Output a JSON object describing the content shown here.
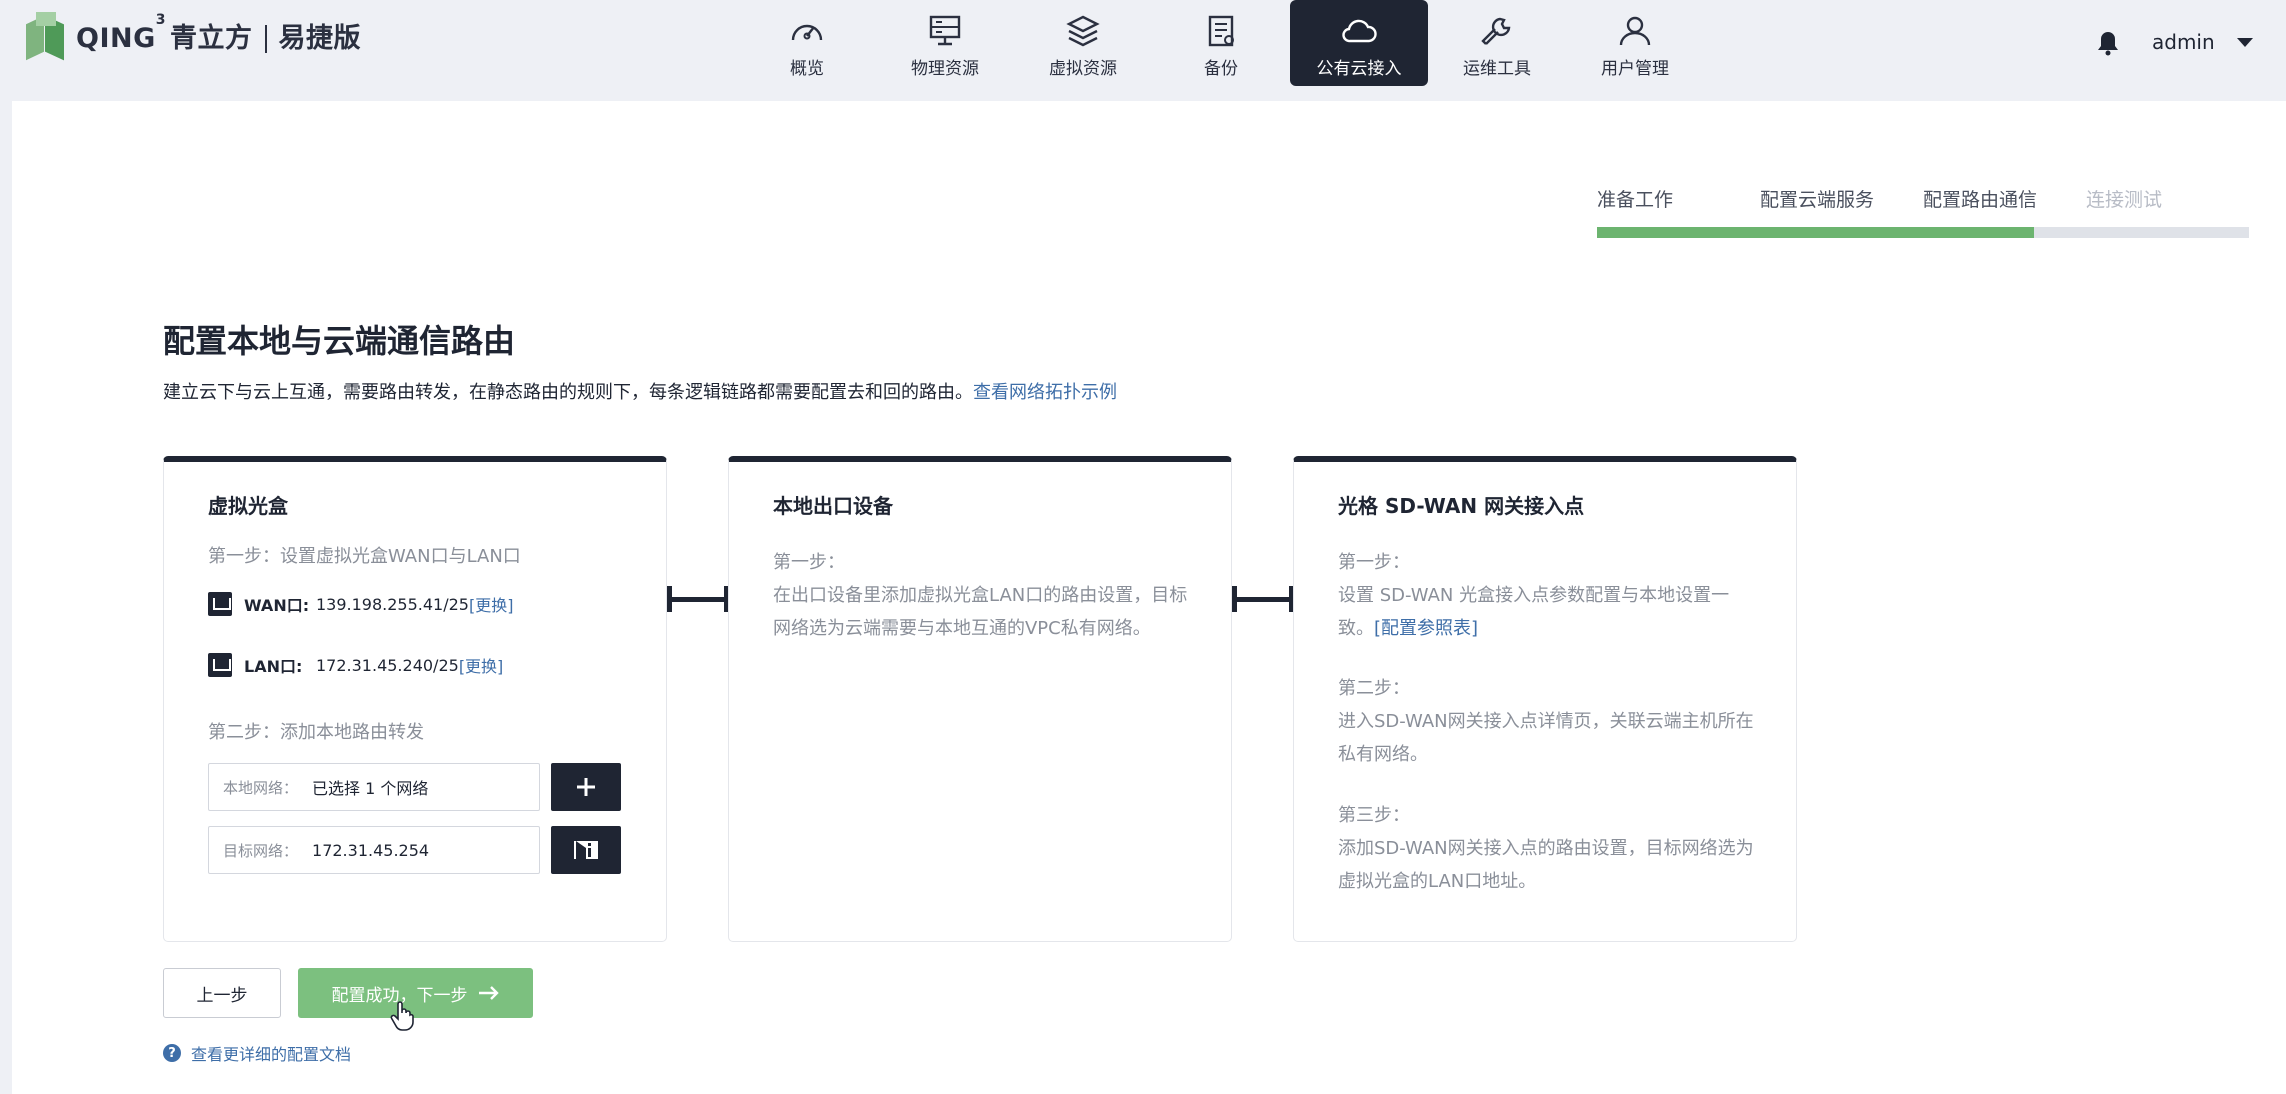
{
  "brand": {
    "logo_name": "QING",
    "logo_sup": "3",
    "logo_cn": "青立方",
    "edition": "易捷版"
  },
  "nav": {
    "items": [
      {
        "label": "概览",
        "icon": "gauge-icon"
      },
      {
        "label": "物理资源",
        "icon": "server-icon"
      },
      {
        "label": "虚拟资源",
        "icon": "layers-icon"
      },
      {
        "label": "备份",
        "icon": "backup-icon"
      },
      {
        "label": "公有云接入",
        "icon": "cloud-icon",
        "active": true
      },
      {
        "label": "运维工具",
        "icon": "wrench-icon"
      },
      {
        "label": "用户管理",
        "icon": "user-icon"
      }
    ]
  },
  "header": {
    "user": "admin"
  },
  "stepper": {
    "steps": [
      "准备工作",
      "配置云端服务",
      "配置路由通信",
      "连接测试"
    ],
    "current_index": 2,
    "progress": 0.67,
    "colors": {
      "done": "#6cb46f",
      "pending": "#dfe2e8"
    }
  },
  "page": {
    "title": "配置本地与云端通信路由",
    "description": "建立云下与云上互通，需要路由转发，在静态路由的规则下，每条逻辑链路都需要配置去和回的路由。",
    "topology_link": "查看网络拓扑示例"
  },
  "cards": {
    "vbox": {
      "title": "虚拟光盒",
      "step1": "第一步：设置虚拟光盒WAN口与LAN口",
      "wan_label": "WAN口:",
      "wan_value": "139.198.255.41/25",
      "wan_change": "[更换]",
      "lan_label": "LAN口:",
      "lan_value": "172.31.45.240/25",
      "lan_change": "[更换]",
      "step2": "第二步：添加本地路由转发",
      "local_label": "本地网络：",
      "local_value": "已选择 1 个网络",
      "target_label": "目标网络：",
      "target_value": "172.31.45.254"
    },
    "local": {
      "title": "本地出口设备",
      "step1_title": "第一步：",
      "step1_body": "在出口设备里添加虚拟光盒LAN口的路由设置，目标网络选为云端需要与本地互通的VPC私有网络。"
    },
    "sdwan": {
      "title": "光格 SD-WAN 网关接入点",
      "step1_title": "第一步：",
      "step1_body": "设置 SD-WAN 光盒接入点参数配置与本地设置一致。",
      "step1_link": "[配置参照表]",
      "step2_title": "第二步：",
      "step2_body": "进入SD-WAN网关接入点详情页，关联云端主机所在私有网络。",
      "step3_title": "第三步：",
      "step3_body": "添加SD-WAN网关接入点的路由设置，目标网络选为虚拟光盒的LAN口地址。"
    }
  },
  "actions": {
    "prev": "上一步",
    "next": "配置成功，下一步",
    "docs": "查看更详细的配置文档"
  },
  "colors": {
    "primary_dark": "#1f2533",
    "success": "#7cc07f",
    "link": "#3e6ea8"
  }
}
